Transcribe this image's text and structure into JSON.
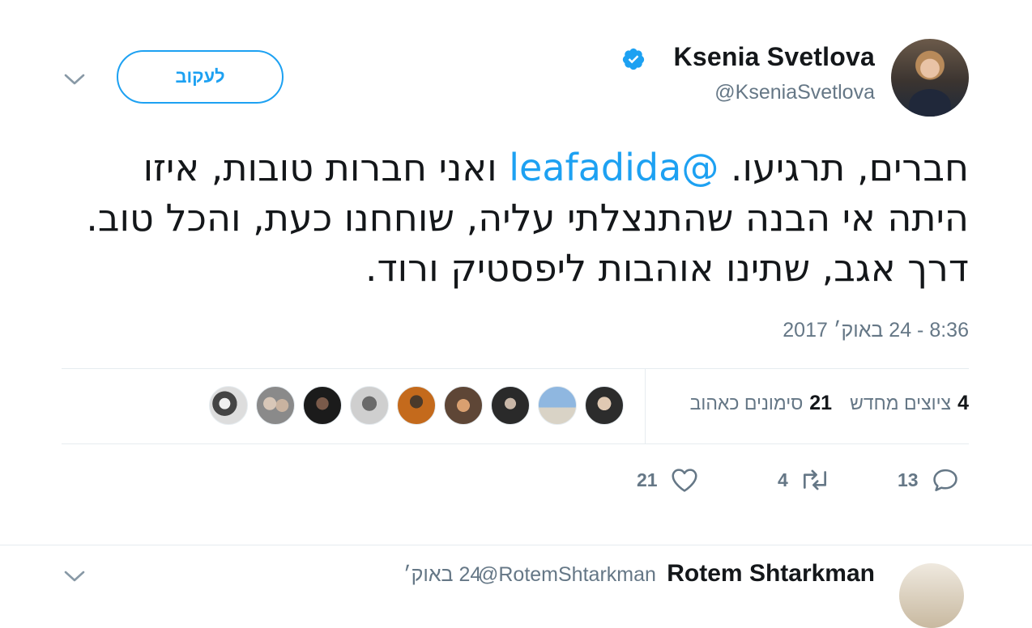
{
  "header": {
    "name": "Ksenia Svetlova",
    "handle": "@KseniaSvetlova",
    "follow_label": "לעקוב"
  },
  "tweet": {
    "text_before": "חברים, תרגיעו. ",
    "mention": "@leafadida",
    "text_after": " ואני חברות טובות, איזו היתה אי הבנה שהתנצלתי עליה, שוחחנו כעת, והכל טוב. דרך אגב, שתינו אוהבות ליפסטיק ורוד.",
    "timestamp": "8:36 - 24 באוק׳ 2017"
  },
  "stats": {
    "retweets_count": "4",
    "retweets_label": "ציוצים מחדש",
    "likes_count": "21",
    "likes_label": "סימונים כאהוב"
  },
  "actions": {
    "reply_count": "13",
    "retweet_count": "4",
    "like_count": "21"
  },
  "icons": [
    "verified-badge-icon",
    "chevron-down-icon",
    "reply-icon",
    "retweet-icon",
    "heart-icon"
  ],
  "colors": {
    "accent": "#1da1f2",
    "text": "#14171a",
    "muted": "#657786",
    "border": "#e6ecf0"
  },
  "next_tweet": {
    "name": "Rotem Shtarkman",
    "handle": "@RotemShtarkman",
    "time": "24 באוק׳"
  }
}
